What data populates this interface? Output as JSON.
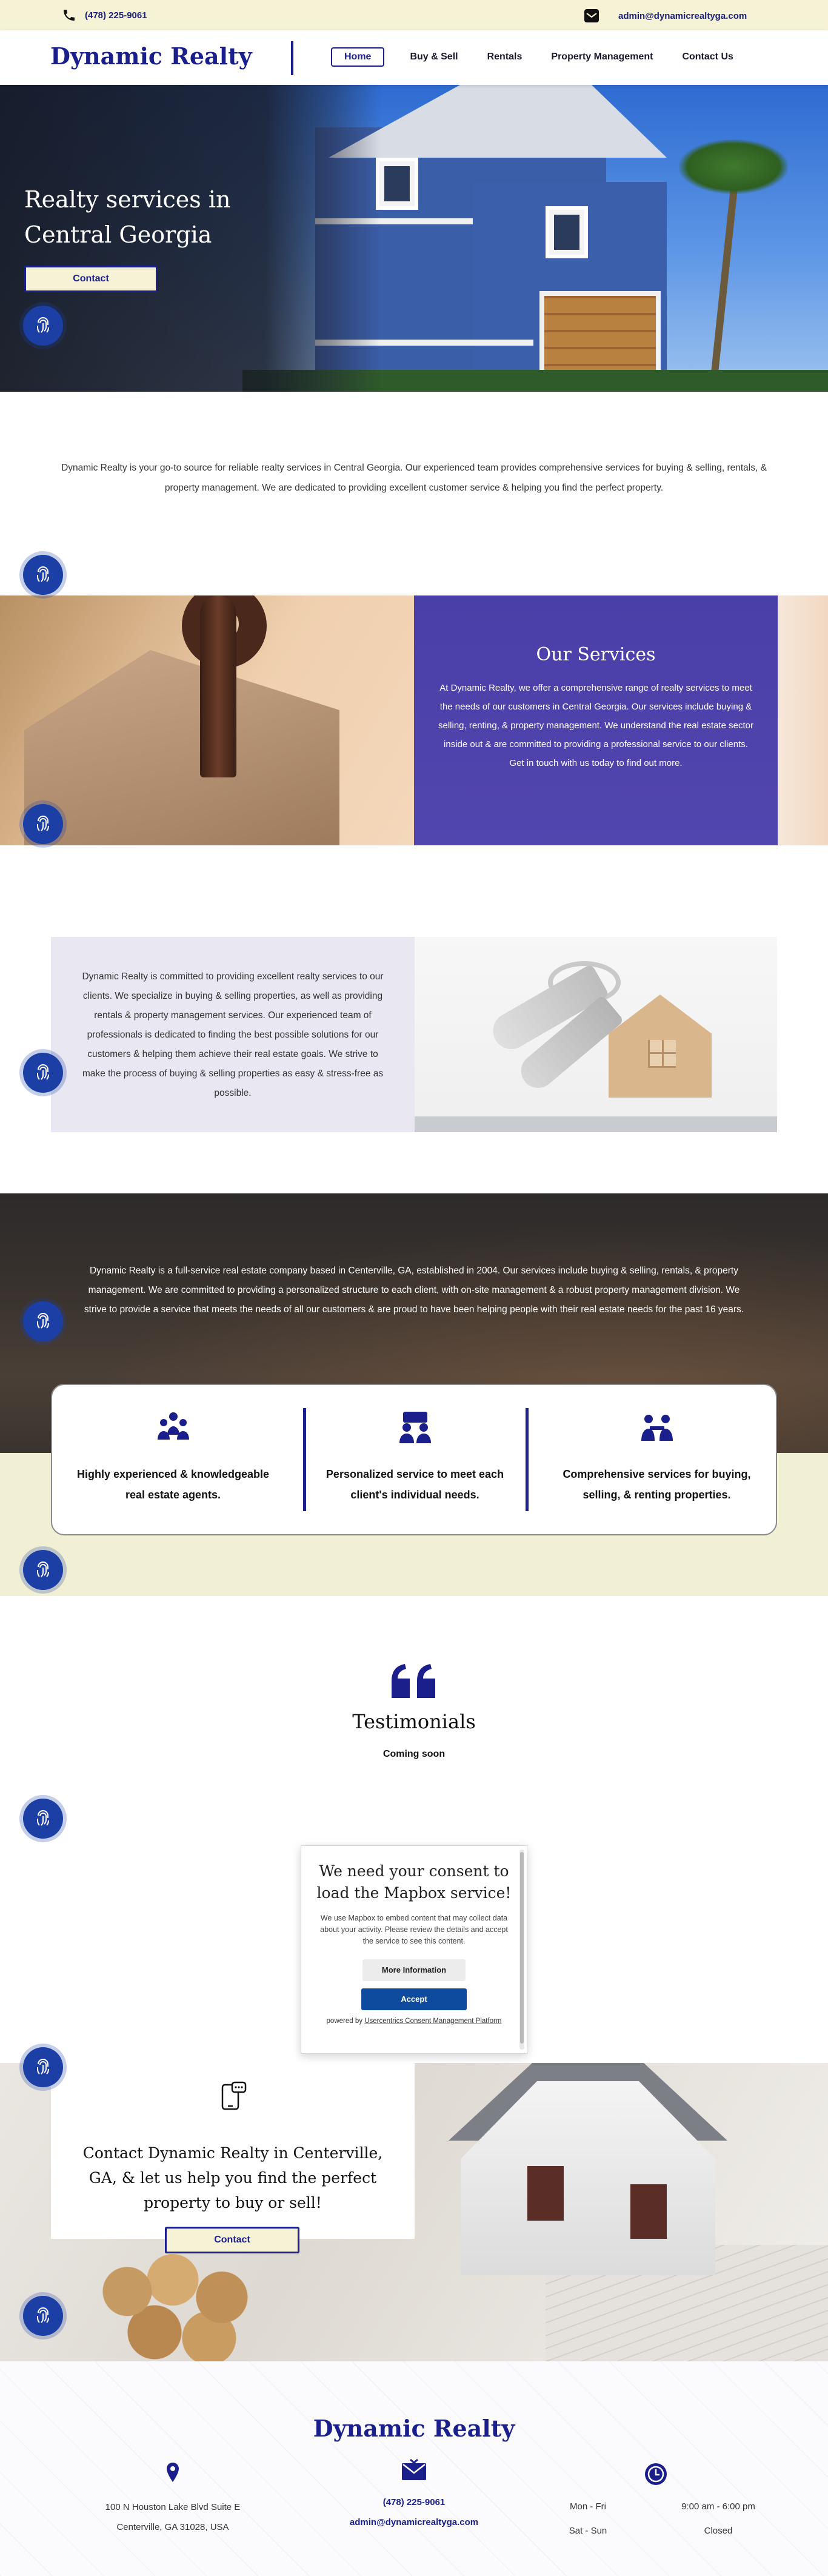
{
  "topbar": {
    "phone": "(478) 225-9061",
    "email": "admin@dynamicrealtyga.com",
    "icons": [
      "phone-icon",
      "mail-icon"
    ]
  },
  "header": {
    "logo": "Dynamic Realty",
    "nav": [
      {
        "label": "Home",
        "active": true
      },
      {
        "label": "Buy & Sell"
      },
      {
        "label": "Rentals"
      },
      {
        "label": "Property Management"
      },
      {
        "label": "Contact Us"
      }
    ]
  },
  "hero": {
    "title": "Realty services in Central Georgia",
    "cta": "Contact"
  },
  "intro": {
    "text": "Dynamic Realty is your go-to source for reliable realty services in Central Georgia. Our experienced team provides comprehensive services for buying & selling, rentals, & property management. We are dedicated to providing excellent customer service & helping you find the perfect property."
  },
  "services": {
    "title": "Our Services",
    "text": "At Dynamic Realty, we offer a comprehensive range of realty services to meet the needs of our customers in Central Georgia. Our services include buying & selling, renting, & property management. We understand the real estate sector inside out & are committed to providing a professional service to our clients. Get in touch with us today to find out more."
  },
  "commitment": {
    "text": "Dynamic Realty is committed to providing excellent realty services to our clients. We specialize in buying & selling properties, as well as providing rentals & property management services. Our experienced team of professionals is dedicated to finding the best possible solutions for our customers & helping them achieve their real estate goals. We strive to make the process of buying & selling properties as easy & stress-free as possible."
  },
  "about": {
    "text": "Dynamic Realty is a full-service real estate company based in Centerville, GA, established in 2004. Our services include buying & selling, rentals, & property management. We are committed to providing a personalized structure to each client, with on-site management & a robust property management division. We strive to provide a service that meets the needs of all our customers & are proud to have been helping people with their real estate needs for the past 16 years."
  },
  "features": [
    {
      "icon": "team-icon",
      "text": "Highly experienced & knowledgeable real estate agents."
    },
    {
      "icon": "meeting-icon",
      "text": "Personalized service to meet each client's individual needs."
    },
    {
      "icon": "conversation-icon",
      "text": "Comprehensive services for buying, selling, & renting properties."
    }
  ],
  "testimonials": {
    "icon": "quote-icon",
    "title": "Testimonials",
    "subtitle": "Coming soon"
  },
  "consent": {
    "title": "We need your consent to load the Mapbox service!",
    "text": "We use Mapbox to embed content that may collect data about your activity. Please review the details and accept the service to see this content.",
    "more": "More Information",
    "accept": "Accept",
    "powered_prefix": "powered by",
    "powered_link": "Usercentrics Consent Management Platform"
  },
  "contact": {
    "icon": "phone-chat-icon",
    "title": "Contact Dynamic Realty in Centerville, GA, & let us help you find the perfect property to buy or sell!",
    "cta": "Contact"
  },
  "footer": {
    "logo": "Dynamic Realty",
    "address_line1": "100 N Houston Lake Blvd Suite E",
    "address_line2": "Centerville, GA 31028, USA",
    "phone": "(478) 225-9061",
    "email": "admin@dynamicrealtyga.com",
    "hours": [
      {
        "days": "Mon - Fri",
        "time": "9:00 am - 6:00 pm"
      },
      {
        "days": "Sat - Sun",
        "time": "Closed"
      }
    ]
  },
  "colors": {
    "brand_blue": "#1a1f8c",
    "cream": "#f5f2d6",
    "purple_panel": "#4a3fa8",
    "fingerprint_badge": "#1c3fa6"
  }
}
